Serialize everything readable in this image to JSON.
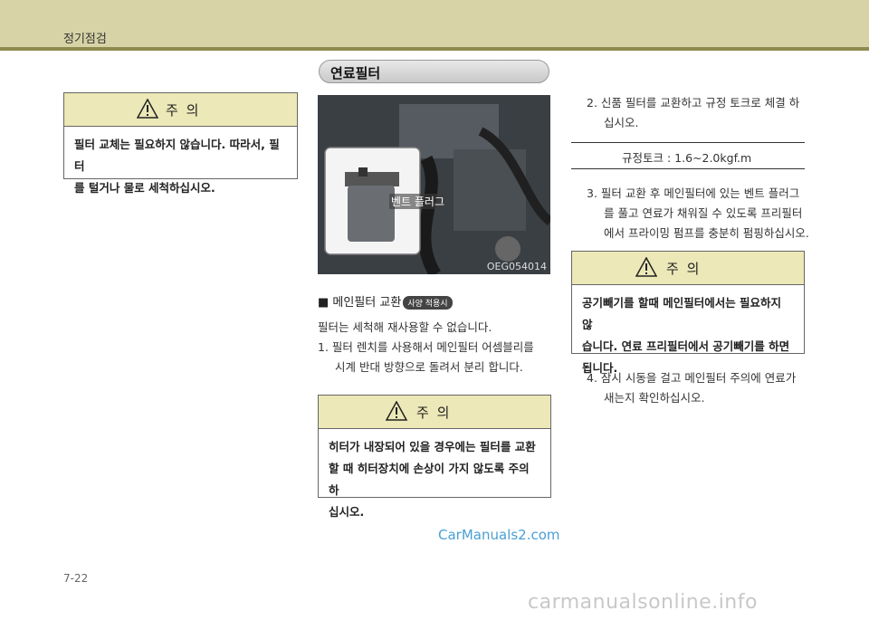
{
  "header": {
    "title": "정기점검"
  },
  "left_caution": {
    "title": "주   의",
    "body": [
      "필터 교체는 필요하지 않습니다. 따라서, 필터",
      "를 털거나 물로 세척하십시오."
    ]
  },
  "section": {
    "title": "연료필터"
  },
  "photo": {
    "label": "벤트 플러그",
    "code": "OEG054014"
  },
  "main_filter": {
    "heading": "■ 메인필터 교환",
    "badge": "사양 적용시",
    "intro": "필터는 세척해 재사용할 수 없습니다.",
    "step1_line1": "1.  필터 렌치를 사용해서 메인필터 어셈블리를",
    "step1_line2": "시계 반대 방향으로 돌려서 분리 합니다."
  },
  "mid_caution": {
    "title": "주   의",
    "body": [
      "히터가 내장되어 있을 경우에는 필터를 교환",
      "할 때 히터장치에 손상이 가지 않도록 주의 하",
      "십시오."
    ]
  },
  "right": {
    "step2_line1": "2.  신품 필터를 교환하고 규정 토크로 체결 하",
    "step2_line2": "십시오.",
    "torque": "규정토크 : 1.6~2.0kgf.m",
    "step3_line1": "3.  필터 교환 후 메인필터에 있는 벤트 플러그",
    "step3_line2": "를 풀고 연료가 채워질 수 있도록 프리필터",
    "step3_line3": "에서 프라이밍 펌프를 충분히 펌핑하십시오.",
    "step4_line1": "4.  잠시 시동을 걸고 메인필터 주의에 연료가",
    "step4_line2": "새는지 확인하십시오."
  },
  "right_caution": {
    "title": "주   의",
    "body": [
      "공기빼기를 할때 메인필터에서는 필요하지 않",
      "습니다. 연료 프리필터에서 공기빼기를 하면",
      "됩니다."
    ]
  },
  "footer": {
    "page_number": "7-22",
    "watermark1": "CarManuals2.com",
    "watermark2": "carmanualsonline.info"
  }
}
